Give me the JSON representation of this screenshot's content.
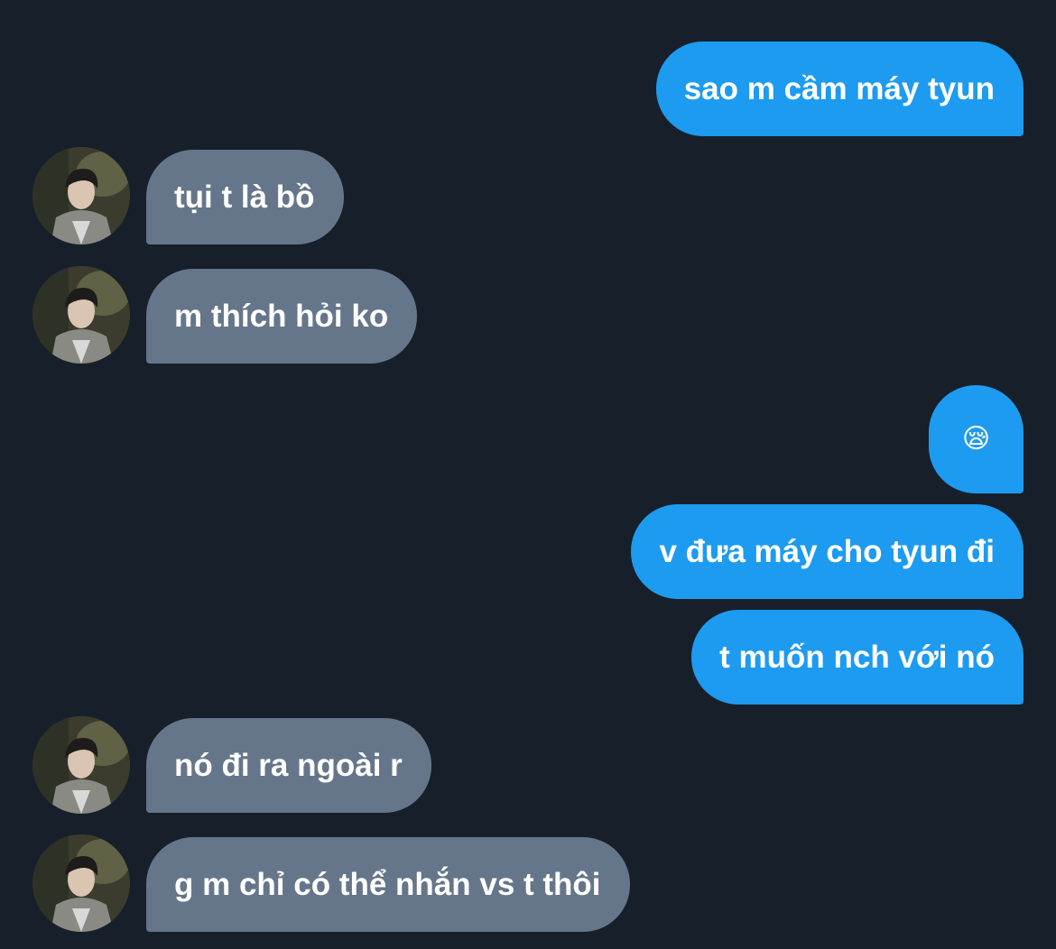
{
  "colors": {
    "background": "#17202a",
    "sent_bubble": "#1d9bf0",
    "received_bubble": "#66768a",
    "text": "#ffffff"
  },
  "messages": [
    {
      "direction": "sent",
      "text": "sao m cầm máy tyun"
    },
    {
      "direction": "received",
      "text": "tụi t là bồ",
      "avatar": "profile-photo"
    },
    {
      "direction": "received",
      "text": "m thích hỏi ko",
      "avatar": "profile-photo"
    },
    {
      "direction": "sent",
      "text": "😪"
    },
    {
      "direction": "sent",
      "text": "v đưa máy cho tyun đi"
    },
    {
      "direction": "sent",
      "text": "t muốn nch với nó"
    },
    {
      "direction": "received",
      "text": "nó đi ra ngoài r",
      "avatar": "profile-photo"
    },
    {
      "direction": "received",
      "text": "g m chỉ có thể nhắn vs t thôi",
      "avatar": "profile-photo"
    }
  ]
}
